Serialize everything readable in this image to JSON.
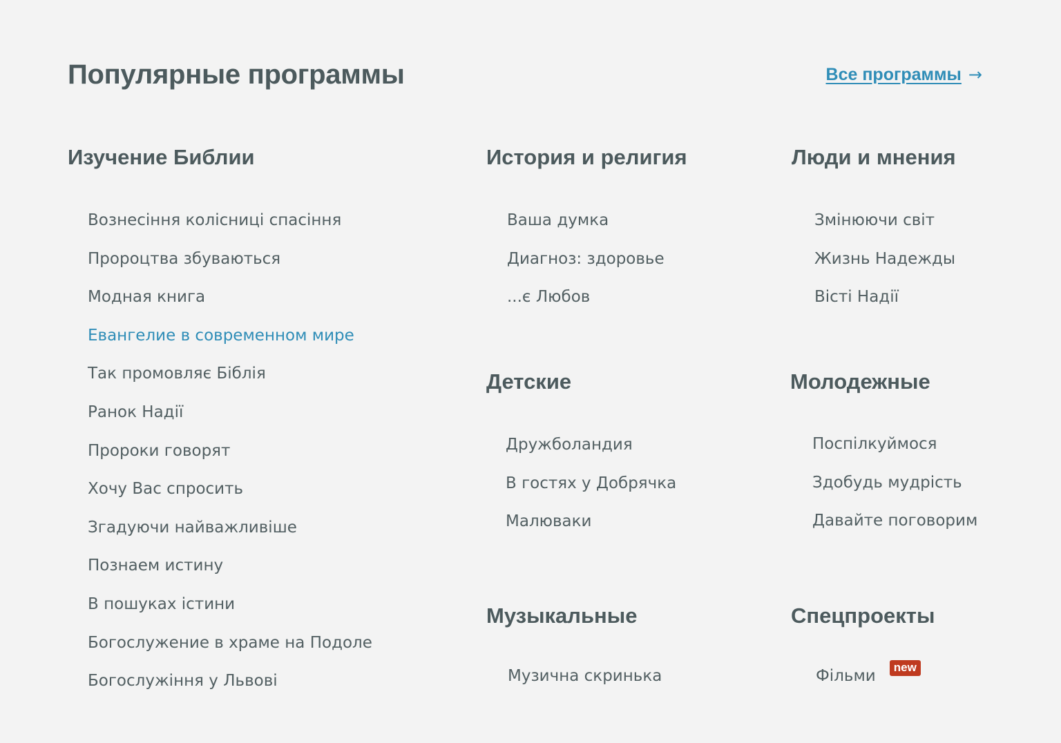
{
  "header": {
    "title": "Популярные программы",
    "all_link_label": "Все программы",
    "all_link_arrow": "→"
  },
  "sections": [
    {
      "title": "Изучение Библии",
      "items": [
        "Вознесіння колісниці спасіння",
        "Пророцтва збуваються",
        "Модная книга",
        "Евангелие в современном мире",
        "Так промовляє Біблія",
        "Ранок Надії",
        "Пророки говорят",
        "Хочу Вас спросить",
        "Згадуючи найважливіше",
        "Познаем истину",
        "В пошуках істини",
        "Богослужение в храме на Подоле",
        "Богослужіння у Львові"
      ]
    },
    {
      "title": "История и религия",
      "items": [
        "Ваша думка",
        "Диагноз: здоровье",
        "...є Любов"
      ]
    },
    {
      "title": "Люди и мнения",
      "items": [
        "Змінюючи світ",
        "Жизнь Надежды",
        "Вісті Надії"
      ]
    },
    {
      "title": "Детские",
      "items": [
        "Дружболандия",
        "В гостях у Добрячка",
        "Малюваки"
      ]
    },
    {
      "title": "Молодежные",
      "items": [
        "Поспілкуймося",
        "Здобудь мудрість",
        "Давайте поговорим"
      ]
    },
    {
      "title": "Музыкальные",
      "items": [
        "Музична скринька"
      ]
    },
    {
      "title": "Спецпроекты",
      "items": [
        "Фільми"
      ],
      "badge": "new"
    }
  ],
  "colors": {
    "accent": "#2f8db7",
    "text": "#525f62",
    "heading": "#4c5a5d",
    "badge": "#bf3a1f",
    "background": "#f3f3f3"
  }
}
